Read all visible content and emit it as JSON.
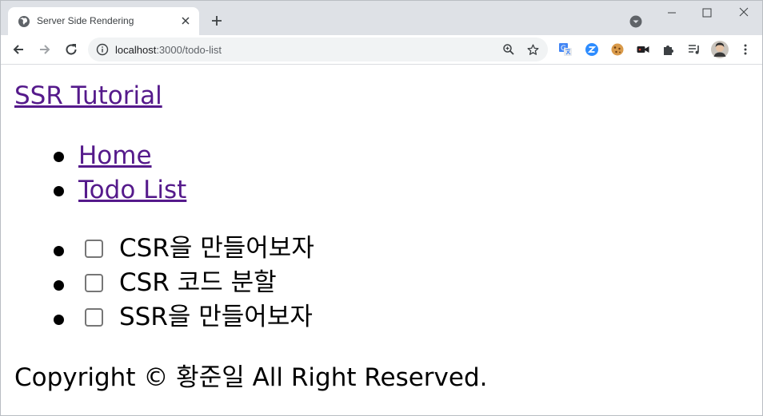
{
  "browser": {
    "tab_title": "Server Side Rendering",
    "url_host": "localhost",
    "url_path": ":3000/todo-list"
  },
  "page": {
    "site_title": "SSR Tutorial",
    "nav": [
      {
        "label": "Home"
      },
      {
        "label": "Todo List"
      }
    ],
    "todos": [
      {
        "text": "CSR을 만들어보자",
        "checked": false
      },
      {
        "text": "CSR 코드 분할",
        "checked": false
      },
      {
        "text": "SSR을 만들어보자",
        "checked": false
      }
    ],
    "footer": "Copyright © 황준일 All Right Reserved."
  },
  "icons": {
    "favicon": "globe-icon",
    "tab_close": "close-icon",
    "new_tab": "plus-icon",
    "tab_search": "chevron-down-icon",
    "back": "arrow-left-icon",
    "forward": "arrow-right-icon",
    "reload": "reload-icon",
    "site_info": "info-icon",
    "zoom": "zoom-icon",
    "bookmark": "star-icon",
    "extensions": [
      "translate-icon",
      "zoom-app-icon",
      "cookie-icon",
      "camera-icon",
      "puzzle-icon",
      "media-queue-icon"
    ],
    "profile": "avatar",
    "menu": "kebab-menu-icon"
  },
  "colors": {
    "link_visited": "#551a8b",
    "tabstrip_bg": "#dee1e6",
    "omnibox_bg": "#f1f3f4"
  }
}
